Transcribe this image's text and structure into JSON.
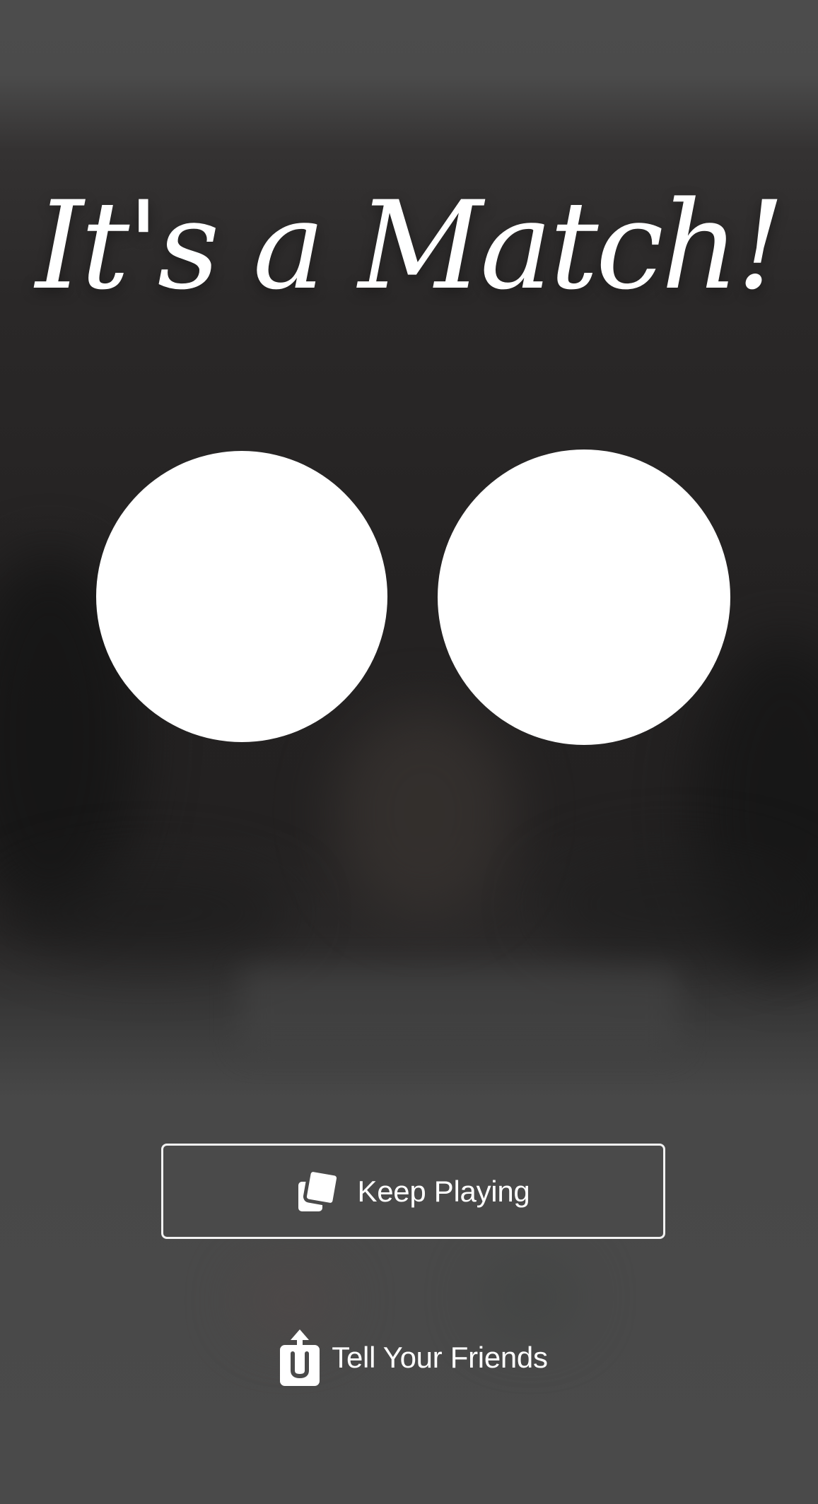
{
  "header": {
    "title": "It's a Match!"
  },
  "avatars": {
    "left_name": "",
    "right_name": ""
  },
  "actions": {
    "keep_playing_label": "Keep Playing",
    "keep_playing_icon": "cards-icon",
    "tell_friends_label": "Tell Your Friends",
    "tell_friends_icon": "share-icon"
  },
  "colors": {
    "background": "#4a4a4a",
    "text": "#ffffff",
    "button_border": "#f2f2f2"
  }
}
